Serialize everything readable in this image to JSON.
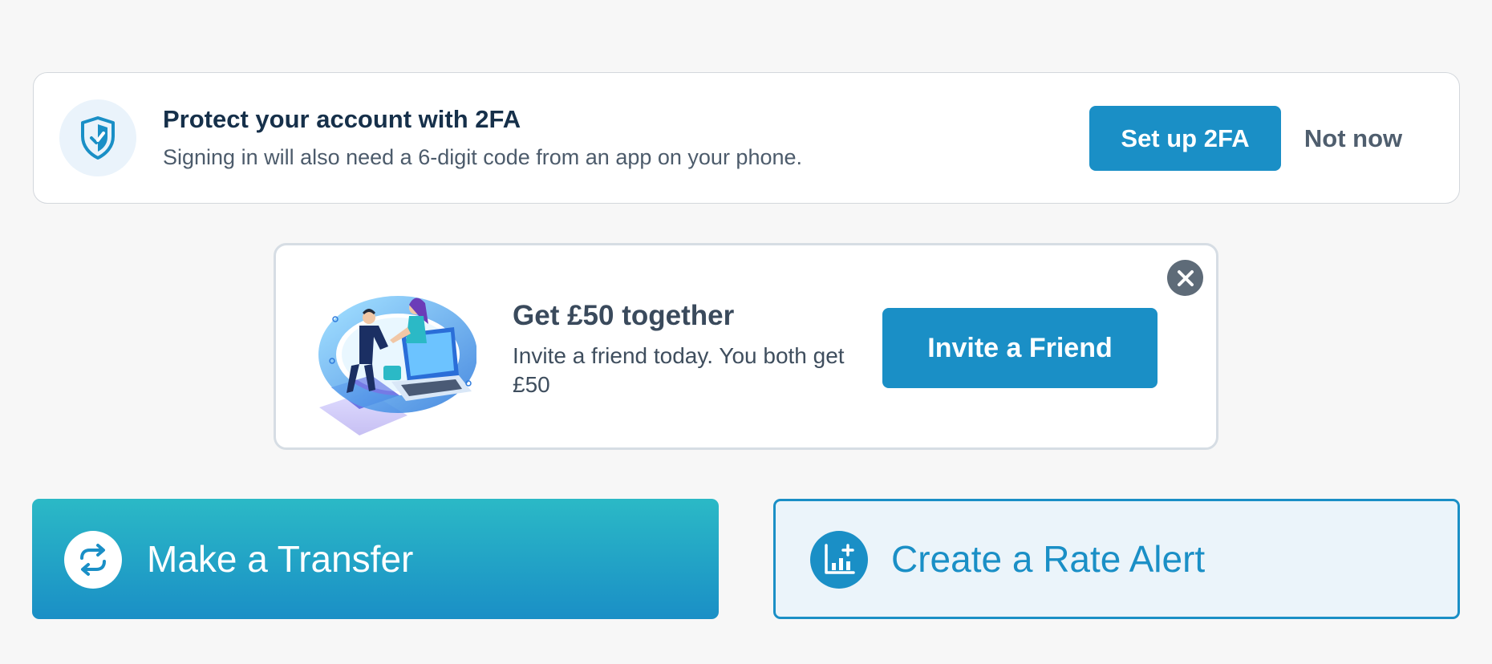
{
  "twofa_banner": {
    "title": "Protect your account with 2FA",
    "description": "Signing in will also need a 6-digit code from an app on your phone.",
    "setup_label": "Set up 2FA",
    "dismiss_label": "Not now",
    "icon": "shield-check-icon"
  },
  "referral": {
    "title": "Get £50 together",
    "description": "Invite a friend today. You both get £50",
    "button_label": "Invite a Friend",
    "close_icon": "close-icon",
    "illustration": "handshake-illustration"
  },
  "actions": {
    "transfer_label": "Make a Transfer",
    "transfer_icon": "transfer-arrows-icon",
    "alert_label": "Create a Rate Alert",
    "alert_icon": "chart-plus-icon"
  },
  "colors": {
    "primary": "#1a8fc6",
    "teal": "#2bb9c6",
    "heading": "#16304a",
    "muted": "#4c5b6b",
    "page_bg": "#f7f7f7"
  }
}
